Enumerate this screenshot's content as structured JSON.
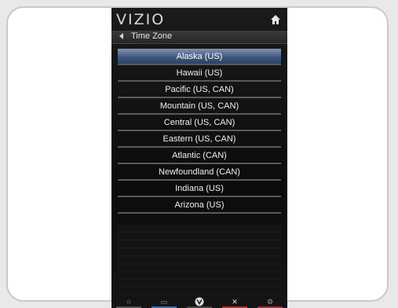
{
  "brand": "VIZIO",
  "header": {
    "home_icon": "home-icon"
  },
  "subheader": {
    "title": "Time Zone",
    "back_icon": "left-triangle-icon"
  },
  "timezones": [
    {
      "label": "Alaska (US)",
      "selected": true
    },
    {
      "label": "Hawaii (US)",
      "selected": false
    },
    {
      "label": "Pacific (US, CAN)",
      "selected": false
    },
    {
      "label": "Mountain (US, CAN)",
      "selected": false
    },
    {
      "label": "Central (US, CAN)",
      "selected": false
    },
    {
      "label": "Eastern (US, CAN)",
      "selected": false
    },
    {
      "label": "Atlantic (CAN)",
      "selected": false
    },
    {
      "label": "Newfoundland (CAN)",
      "selected": false
    },
    {
      "label": "Indiana (US)",
      "selected": false
    },
    {
      "label": "Arizona (US)",
      "selected": false
    }
  ],
  "footer": {
    "buttons": [
      {
        "icon": "star-icon",
        "color": "#555555"
      },
      {
        "icon": "menu-icon",
        "color": "#3a6fb0"
      },
      {
        "icon": "v-logo-icon",
        "color": "#444444"
      },
      {
        "icon": "close-icon",
        "color": "#b03030"
      },
      {
        "icon": "settings-icon",
        "color": "#a03040"
      }
    ]
  },
  "colors": {
    "selected_row": "#3d5478",
    "panel_bg": "#111111",
    "separator": "#5a5a5a"
  }
}
